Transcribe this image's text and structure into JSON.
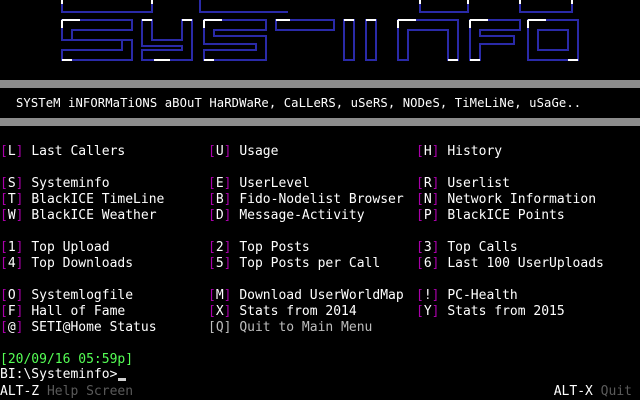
{
  "colors": {
    "background": "#000000",
    "bracket": "#aa00aa",
    "text": "#ffffff",
    "separator": "#8c8c8c",
    "timestamp": "#55ff55",
    "banner_outline": "#2a2aa8",
    "banner_highlight": "#ffffff",
    "status_hint": "#5a5a5a"
  },
  "banner": {
    "logo_text": "SYSINFO",
    "tagline": "SYSTeM iNFORMaTiONS aBOuT HaRDWaRe, CaLLeRS, uSeRS, NODeS, TiMeLiNe, uSaGe.."
  },
  "menu": {
    "groups": [
      [
        {
          "key": "L",
          "label": "Last Callers"
        },
        {
          "key": "U",
          "label": "Usage"
        },
        {
          "key": "H",
          "label": "History"
        }
      ],
      [
        {
          "key": "S",
          "label": "Systeminfo"
        },
        {
          "key": "E",
          "label": "UserLevel"
        },
        {
          "key": "R",
          "label": "Userlist"
        },
        {
          "key": "T",
          "label": "BlackICE TimeLine"
        },
        {
          "key": "B",
          "label": "Fido-Nodelist Browser"
        },
        {
          "key": "N",
          "label": "Network Information"
        },
        {
          "key": "W",
          "label": "BlackICE Weather"
        },
        {
          "key": "D",
          "label": "Message-Activity"
        },
        {
          "key": "P",
          "label": "BlackICE Points"
        }
      ],
      [
        {
          "key": "1",
          "label": "Top Upload"
        },
        {
          "key": "2",
          "label": "Top Posts"
        },
        {
          "key": "3",
          "label": "Top Calls"
        },
        {
          "key": "4",
          "label": "Top Downloads"
        },
        {
          "key": "5",
          "label": "Top Posts per Call"
        },
        {
          "key": "6",
          "label": "Last 100 UserUploads"
        }
      ],
      [
        {
          "key": "O",
          "label": "Systemlogfile"
        },
        {
          "key": "M",
          "label": "Download UserWorldMap"
        },
        {
          "key": "!",
          "label": "PC-Health"
        },
        {
          "key": "F",
          "label": "Hall of Fame"
        },
        {
          "key": "X",
          "label": "Stats from 2014"
        },
        {
          "key": "Y",
          "label": "Stats from 2015"
        },
        {
          "key": "@",
          "label": "SETI@Home Status"
        },
        {
          "key": "Q",
          "label": "Quit to Main Menu",
          "dim": true
        }
      ]
    ]
  },
  "session": {
    "timestamp": "[20/09/16 05:59p]",
    "prompt": "BI:\\Systeminfo>"
  },
  "status_bar": {
    "left_key": "ALT-Z",
    "left_text": " Help Screen",
    "right_key": "ALT-X",
    "right_text": " Quit"
  }
}
